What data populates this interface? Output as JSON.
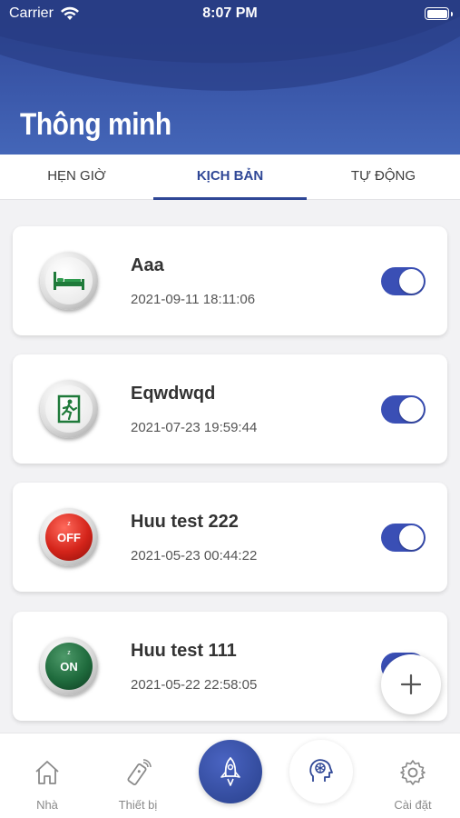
{
  "status_bar": {
    "carrier": "Carrier",
    "time": "8:07 PM"
  },
  "header": {
    "title": "Thông minh"
  },
  "tabs": [
    {
      "label": "HẸN GIỜ",
      "active": false
    },
    {
      "label": "KỊCH BẢN",
      "active": true
    },
    {
      "label": "TỰ ĐỘNG",
      "active": false
    }
  ],
  "scenarios": [
    {
      "name": "Aaa",
      "date": "2021-09-11 18:11:06",
      "icon": "bed-icon",
      "enabled": true
    },
    {
      "name": "Eqwdwqd",
      "date": "2021-07-23 19:59:44",
      "icon": "exit-icon",
      "enabled": true
    },
    {
      "name": "Huu test 222",
      "date": "2021-05-23 00:44:22",
      "icon": "off-icon",
      "icon_text": "OFF",
      "enabled": true
    },
    {
      "name": "Huu test 111",
      "date": "2021-05-22 22:58:05",
      "icon": "on-icon",
      "icon_text": "ON",
      "enabled": true
    }
  ],
  "fab": {
    "label": "+"
  },
  "bottom_nav": {
    "home": "Nhà",
    "devices": "Thiết bị",
    "settings": "Cài đặt"
  },
  "colors": {
    "primary": "#2f4796",
    "toggle": "#3a4fb5",
    "off_red": "#d4241a",
    "on_green": "#1f6b3d"
  }
}
